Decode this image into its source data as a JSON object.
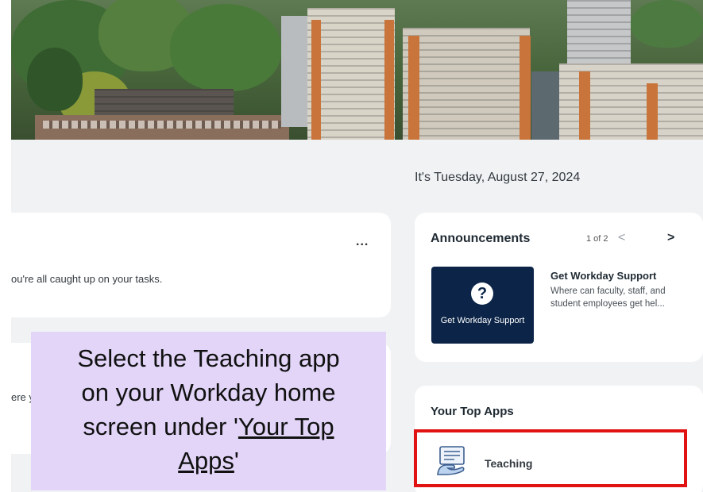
{
  "header": {
    "date_text": "It's Tuesday, August 27, 2024"
  },
  "tasks": {
    "more_label": "...",
    "message": "ou're all caught up on your tasks."
  },
  "second_card": {
    "fragment": "ere y"
  },
  "announcements": {
    "title": "Announcements",
    "pager": "1 of 2",
    "prev": "<",
    "next": ">",
    "tile_label": "Get Workday Support",
    "tile_icon": "question-icon",
    "item_title": "Get Workday Support",
    "item_desc": "Where can faculty, staff, and student employees get hel..."
  },
  "top_apps": {
    "title": "Your Top Apps",
    "items": [
      {
        "label": "Teaching",
        "icon": "teaching-icon"
      }
    ]
  },
  "callout": {
    "line1": "Select the Teaching app",
    "line2": "on your Workday home",
    "line3_pre": "screen under '",
    "line3_link": "Your Top",
    "line4_link": "Apps",
    "line4_post": "'"
  },
  "colors": {
    "highlight_border": "#e01212",
    "callout_bg": "#e2d5f8",
    "tile_bg": "#0b2447"
  }
}
